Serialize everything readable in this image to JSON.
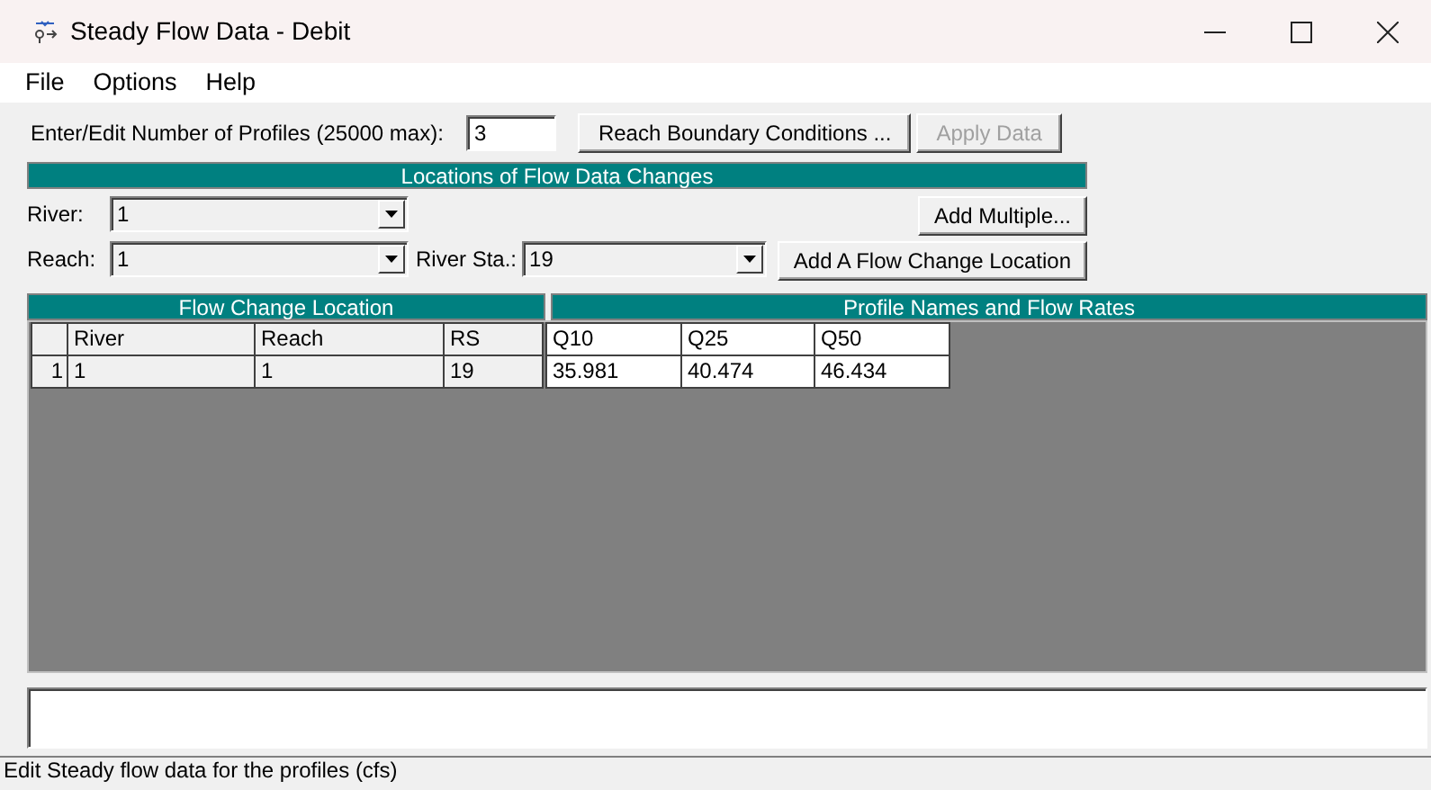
{
  "window": {
    "title": "Steady Flow Data - Debit"
  },
  "menu": [
    "File",
    "Options",
    "Help"
  ],
  "profiles": {
    "label": "Enter/Edit Number of Profiles (25000 max):",
    "value": "3"
  },
  "top_buttons": [
    {
      "label": "Reach Boundary Conditions ...",
      "disabled": false
    },
    {
      "label": "Apply Data",
      "disabled": true
    }
  ],
  "locations": {
    "title": "Locations of Flow Data Changes",
    "river": {
      "label": "River:",
      "value": "1"
    },
    "reach": {
      "label": "Reach:",
      "value": "1"
    },
    "river_sta": {
      "label": "River Sta.:",
      "value": "19"
    },
    "buttons": [
      "Add Multiple...",
      "Add A Flow Change Location"
    ]
  },
  "table": {
    "group_headers": [
      "Flow Change Location",
      "Profile Names and Flow Rates"
    ],
    "columns": [
      {
        "label": "River",
        "kind": "location"
      },
      {
        "label": "Reach",
        "kind": "location"
      },
      {
        "label": "RS",
        "kind": "location"
      },
      {
        "label": "Q10",
        "kind": "profile"
      },
      {
        "label": "Q25",
        "kind": "profile"
      },
      {
        "label": "Q50",
        "kind": "profile"
      }
    ],
    "rows": [
      {
        "number": "1",
        "cells": [
          "1",
          "1",
          "19",
          "35.981",
          "40.474",
          "46.434"
        ]
      }
    ]
  },
  "status_bar": "Edit Steady flow data for the profiles (cfs)"
}
